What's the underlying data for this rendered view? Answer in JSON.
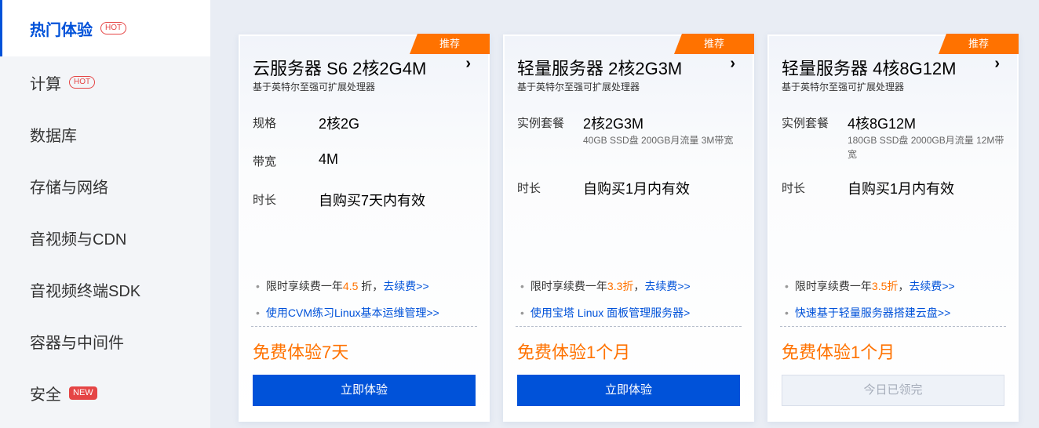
{
  "sidebar": {
    "items": [
      {
        "label": "热门体验",
        "tag": "HOT"
      },
      {
        "label": "计算",
        "tag": "HOT"
      },
      {
        "label": "数据库"
      },
      {
        "label": "存储与网络"
      },
      {
        "label": "音视频与CDN"
      },
      {
        "label": "音视频终端SDK"
      },
      {
        "label": "容器与中间件"
      },
      {
        "label": "安全",
        "tag": "NEW"
      }
    ]
  },
  "cards": [
    {
      "tag": "推荐",
      "title": "云服务器 S6 2核2G4M",
      "arrow": "›",
      "subtitle": "基于英特尔至强可扩展处理器",
      "specs": [
        {
          "label": "规格",
          "value": "2核2G"
        },
        {
          "label": "带宽",
          "value": "4M"
        },
        {
          "label": "时长",
          "value": "自购买7天内有效"
        }
      ],
      "renew": {
        "prefix": "限时享续费一年",
        "discount": "4.5",
        "suffix": " 折，",
        "link": "去续费>>"
      },
      "guide_link": "使用CVM练习Linux基本运维管理>>",
      "offer": "免费体验7天",
      "button": "立即体验"
    },
    {
      "tag": "推荐",
      "title": "轻量服务器 2核2G3M",
      "arrow": "›",
      "subtitle": "基于英特尔至强可扩展处理器",
      "specs": [
        {
          "label": "实例套餐",
          "value": "2核2G3M",
          "note": "40GB SSD盘 200GB月流量 3M带宽"
        },
        {
          "label": "时长",
          "value": "自购买1月内有效"
        }
      ],
      "renew": {
        "prefix": "限时享续费一年",
        "discount": "3.3折",
        "suffix": "，",
        "link": "去续费>>"
      },
      "guide_link": "使用宝塔 Linux 面板管理服务器>",
      "offer": "免费体验1个月",
      "button": "立即体验"
    },
    {
      "tag": "推荐",
      "title": "轻量服务器 4核8G12M",
      "arrow": "›",
      "subtitle": "基于英特尔至强可扩展处理器",
      "specs": [
        {
          "label": "实例套餐",
          "value": "4核8G12M",
          "note": "180GB SSD盘 2000GB月流量 12M带宽"
        },
        {
          "label": "时长",
          "value": "自购买1月内有效"
        }
      ],
      "renew": {
        "prefix": "限时享续费一年",
        "discount": "3.5折",
        "suffix": "，",
        "link": "去续费>>"
      },
      "guide_link": "快速基于轻量服务器搭建云盘>>",
      "offer": "免费体验1个月",
      "button": "今日已领完"
    }
  ]
}
